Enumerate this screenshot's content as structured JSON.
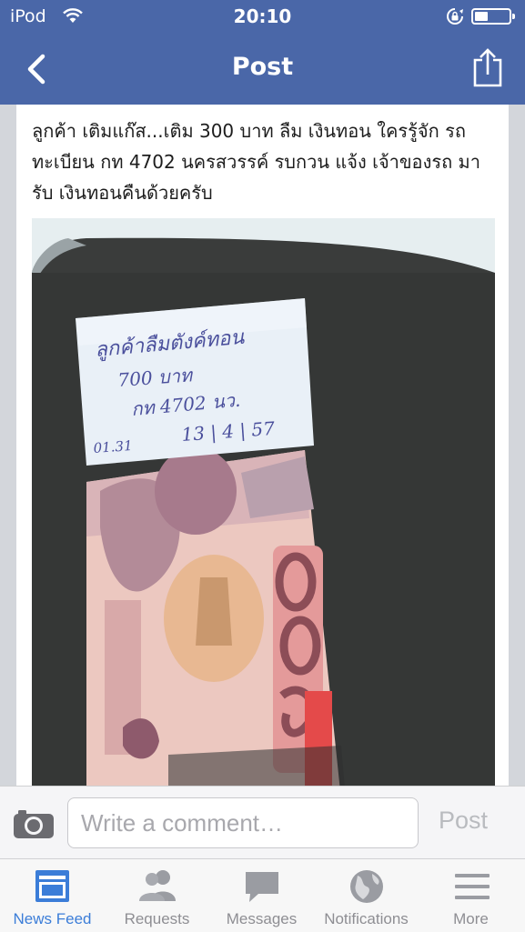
{
  "status_bar": {
    "carrier": "iPod",
    "time": "20:10"
  },
  "nav": {
    "title": "Post"
  },
  "post": {
    "text": "ลูกค้า เติมแก๊ส...เติม 300 บาท ลืม เงินทอน ใครรู้จัก รถ ทะเบียน กท 4702 นครสวรรค์ รบกวน แจ้ง เจ้าของรถ มารับ เงินทอนคืนด้วยครับ",
    "photo": {
      "note_lines": [
        "ลูกค้าลืมตังค์ทอน",
        "700 บาท",
        "กท 4702  นว.",
        "13 | 4 | 57"
      ],
      "note_time": "01.31"
    }
  },
  "comment_bar": {
    "placeholder": "Write a comment…",
    "post_label": "Post"
  },
  "tabs": [
    {
      "label": "News Feed",
      "icon": "news-feed-icon",
      "active": true
    },
    {
      "label": "Requests",
      "icon": "friend-requests-icon"
    },
    {
      "label": "Messages",
      "icon": "messages-icon"
    },
    {
      "label": "Notifications",
      "icon": "globe-icon"
    },
    {
      "label": "More",
      "icon": "menu-icon"
    }
  ],
  "colors": {
    "brand": "#4a67a8",
    "active_tab": "#3b7dd8",
    "inactive_tab": "#8e8e93"
  }
}
